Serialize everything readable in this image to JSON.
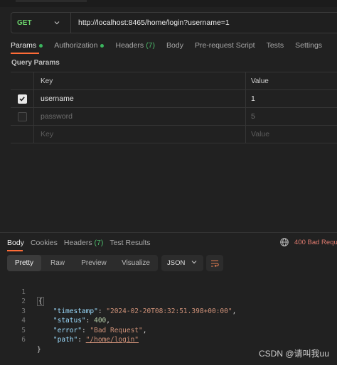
{
  "request": {
    "method": "GET",
    "url": "http://localhost:8465/home/login?username=1"
  },
  "request_tabs": [
    {
      "label": "Params",
      "dot": true
    },
    {
      "label": "Authorization",
      "dot": true
    },
    {
      "label": "Headers",
      "count": "(7)"
    },
    {
      "label": "Body"
    },
    {
      "label": "Pre-request Script"
    },
    {
      "label": "Tests"
    },
    {
      "label": "Settings"
    }
  ],
  "query_params": {
    "title": "Query Params",
    "header": {
      "key": "Key",
      "value": "Value"
    },
    "rows": [
      {
        "checked": true,
        "key": "username",
        "value": "1"
      },
      {
        "checked": false,
        "key": "password",
        "value": "5"
      }
    ],
    "placeholder": {
      "key": "Key",
      "value": "Value"
    }
  },
  "response_tabs": [
    {
      "label": "Body"
    },
    {
      "label": "Cookies"
    },
    {
      "label": "Headers",
      "count": "(7)"
    },
    {
      "label": "Test Results"
    }
  ],
  "response_status": "400 Bad Reque",
  "response_toolbar": {
    "views": [
      "Pretty",
      "Raw",
      "Preview",
      "Visualize"
    ],
    "active_view": "Pretty",
    "format": "JSON"
  },
  "response_body": {
    "line_numbers": [
      "1",
      "2",
      "3",
      "4",
      "5",
      "6"
    ],
    "open_brace": "{",
    "close_brace": "}",
    "fields": [
      {
        "key": "\"timestamp\"",
        "value": "\"2024-02-20T08:32:51.398+00:00\"",
        "type": "string",
        "sep": ","
      },
      {
        "key": "\"status\"",
        "value": "400",
        "type": "number",
        "sep": ","
      },
      {
        "key": "\"error\"",
        "value": "\"Bad Request\"",
        "type": "string",
        "sep": ","
      },
      {
        "key": "\"path\"",
        "value": "\"/home/login\"",
        "type": "link",
        "sep": ""
      }
    ]
  },
  "watermark": "CSDN @请叫我uu",
  "colors": {
    "accent": "#ff6c37",
    "method_get": "#6bd26b",
    "status_error": "#e07b6f",
    "dot_green": "#3bb55e"
  }
}
